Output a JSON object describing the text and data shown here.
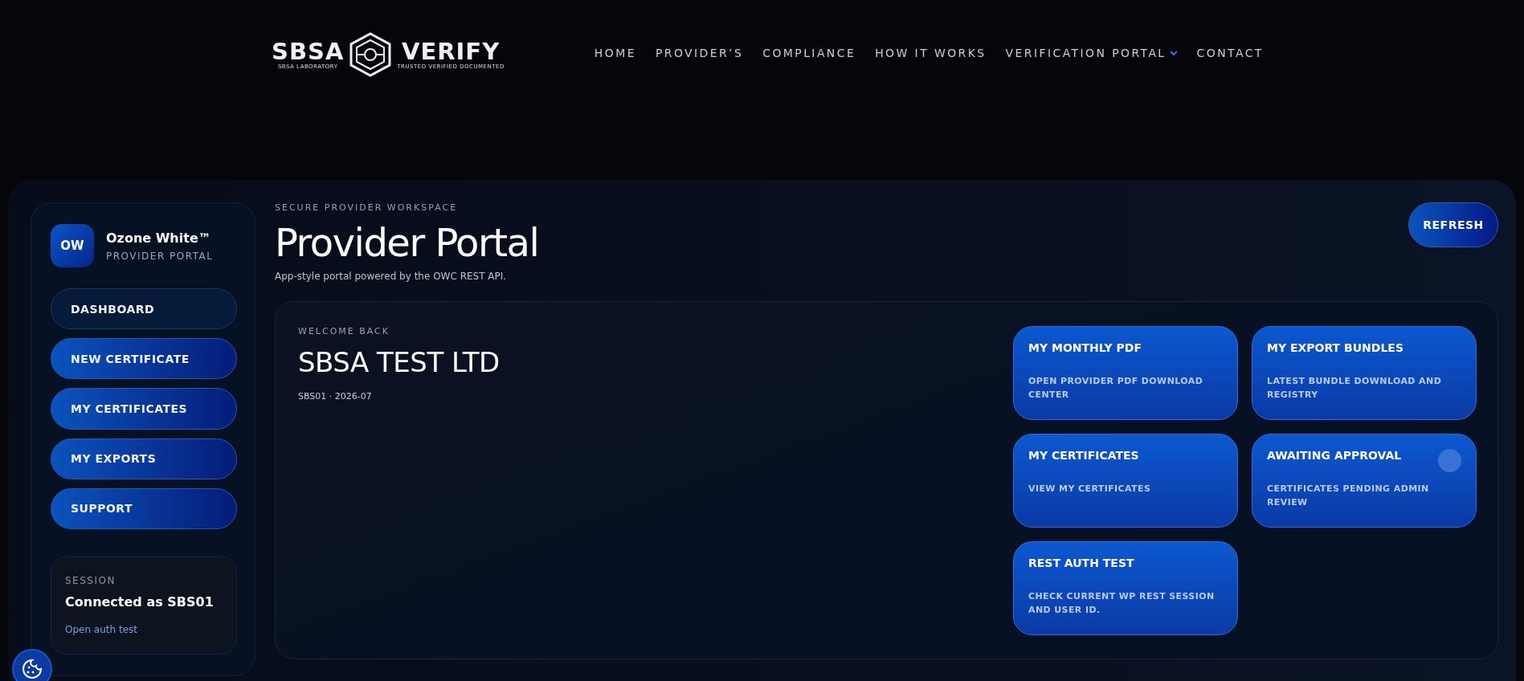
{
  "logo": {
    "left": "SBSA",
    "right": "VERIFY",
    "left_tagline": "SBSA LABORATORY",
    "right_tagline": "TRUSTED VERIFIED DOCUMENTED"
  },
  "nav": [
    {
      "label": "HOME",
      "dropdown": false
    },
    {
      "label": "PROVIDER’S",
      "dropdown": false
    },
    {
      "label": "COMPLIANCE",
      "dropdown": false
    },
    {
      "label": "HOW IT WORKS",
      "dropdown": false
    },
    {
      "label": "VERIFICATION PORTAL",
      "dropdown": true
    },
    {
      "label": "CONTACT",
      "dropdown": false
    }
  ],
  "sidebar": {
    "avatar": "OW",
    "name": "Ozone White™",
    "subtitle": "PROVIDER PORTAL",
    "items": [
      {
        "label": "DASHBOARD",
        "selected": true
      },
      {
        "label": "NEW CERTIFICATE",
        "selected": false
      },
      {
        "label": "MY CERTIFICATES",
        "selected": false
      },
      {
        "label": "MY EXPORTS",
        "selected": false
      },
      {
        "label": "SUPPORT",
        "selected": false
      }
    ],
    "session": {
      "label": "SESSION",
      "status": "Connected as SBS01",
      "link": "Open auth test"
    }
  },
  "header": {
    "eyebrow": "SECURE PROVIDER WORKSPACE",
    "title": "Provider Portal",
    "subtitle": "App-style portal powered by the OWC REST API.",
    "button": "REFRESH"
  },
  "welcome": {
    "eyebrow": "WELCOME BACK",
    "company": "SBSA TEST LTD",
    "meta": "SBS01 · 2026-07"
  },
  "tiles": [
    {
      "title": "MY MONTHLY PDF",
      "description": "OPEN PROVIDER PDF DOWNLOAD CENTER",
      "indicator": false
    },
    {
      "title": "MY EXPORT BUNDLES",
      "description": "LATEST BUNDLE DOWNLOAD AND REGISTRY",
      "indicator": false
    },
    {
      "title": "MY CERTIFICATES",
      "description": "VIEW MY CERTIFICATES",
      "indicator": false
    },
    {
      "title": "AWAITING APPROVAL",
      "description": "CERTIFICATES PENDING ADMIN REVIEW",
      "indicator": true
    },
    {
      "title": "REST AUTH TEST",
      "description": "CHECK CURRENT WP REST SESSION AND USER ID.",
      "indicator": false
    }
  ]
}
